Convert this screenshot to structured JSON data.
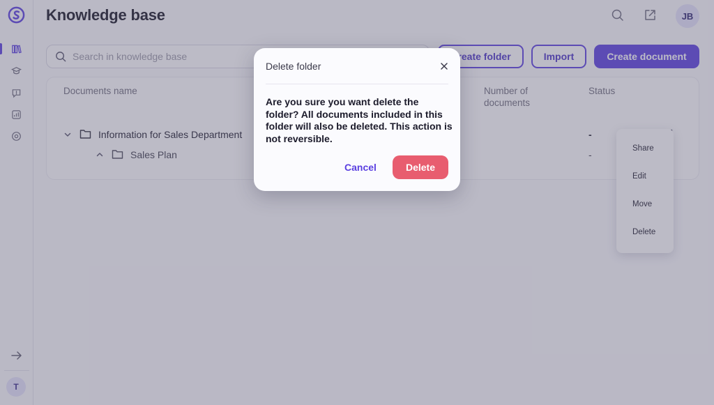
{
  "sidebar": {
    "logo": "brand-logo-icon",
    "items": [
      {
        "icon": "library-icon",
        "active": true
      },
      {
        "icon": "graduation-cap-icon",
        "active": false
      },
      {
        "icon": "chat-alert-icon",
        "active": false
      },
      {
        "icon": "analytics-icon",
        "active": false
      },
      {
        "icon": "settings-icon",
        "active": false
      }
    ],
    "collapse_icon": "arrow-right-icon",
    "team_initial": "T"
  },
  "header": {
    "title": "Knowledge base",
    "search_icon": "search-icon",
    "share_icon": "external-link-icon",
    "user_initials": "JB"
  },
  "toolbar": {
    "search_placeholder": "Search in knowledge base",
    "create_folder_label": "Create folder",
    "import_label": "Import",
    "create_document_label": "Create document"
  },
  "table": {
    "columns": {
      "name": "Documents name",
      "count": "Number of documents",
      "status": "Status"
    },
    "rows": [
      {
        "name": "Information for Sales Department",
        "status": "-",
        "expanded": true
      },
      {
        "name": "Sales Plan",
        "status": "-",
        "expanded": false
      }
    ]
  },
  "context_menu": {
    "items": [
      "Share",
      "Edit",
      "Move",
      "Delete"
    ]
  },
  "modal": {
    "title": "Delete folder",
    "body": "Are you sure you want delete the folder? All documents included in this folder will also be deleted. This action is not reversible.",
    "cancel_label": "Cancel",
    "delete_label": "Delete"
  },
  "colors": {
    "accent": "#5a3fe0",
    "danger": "#e85d6f",
    "overlay": "#5f5c76"
  }
}
